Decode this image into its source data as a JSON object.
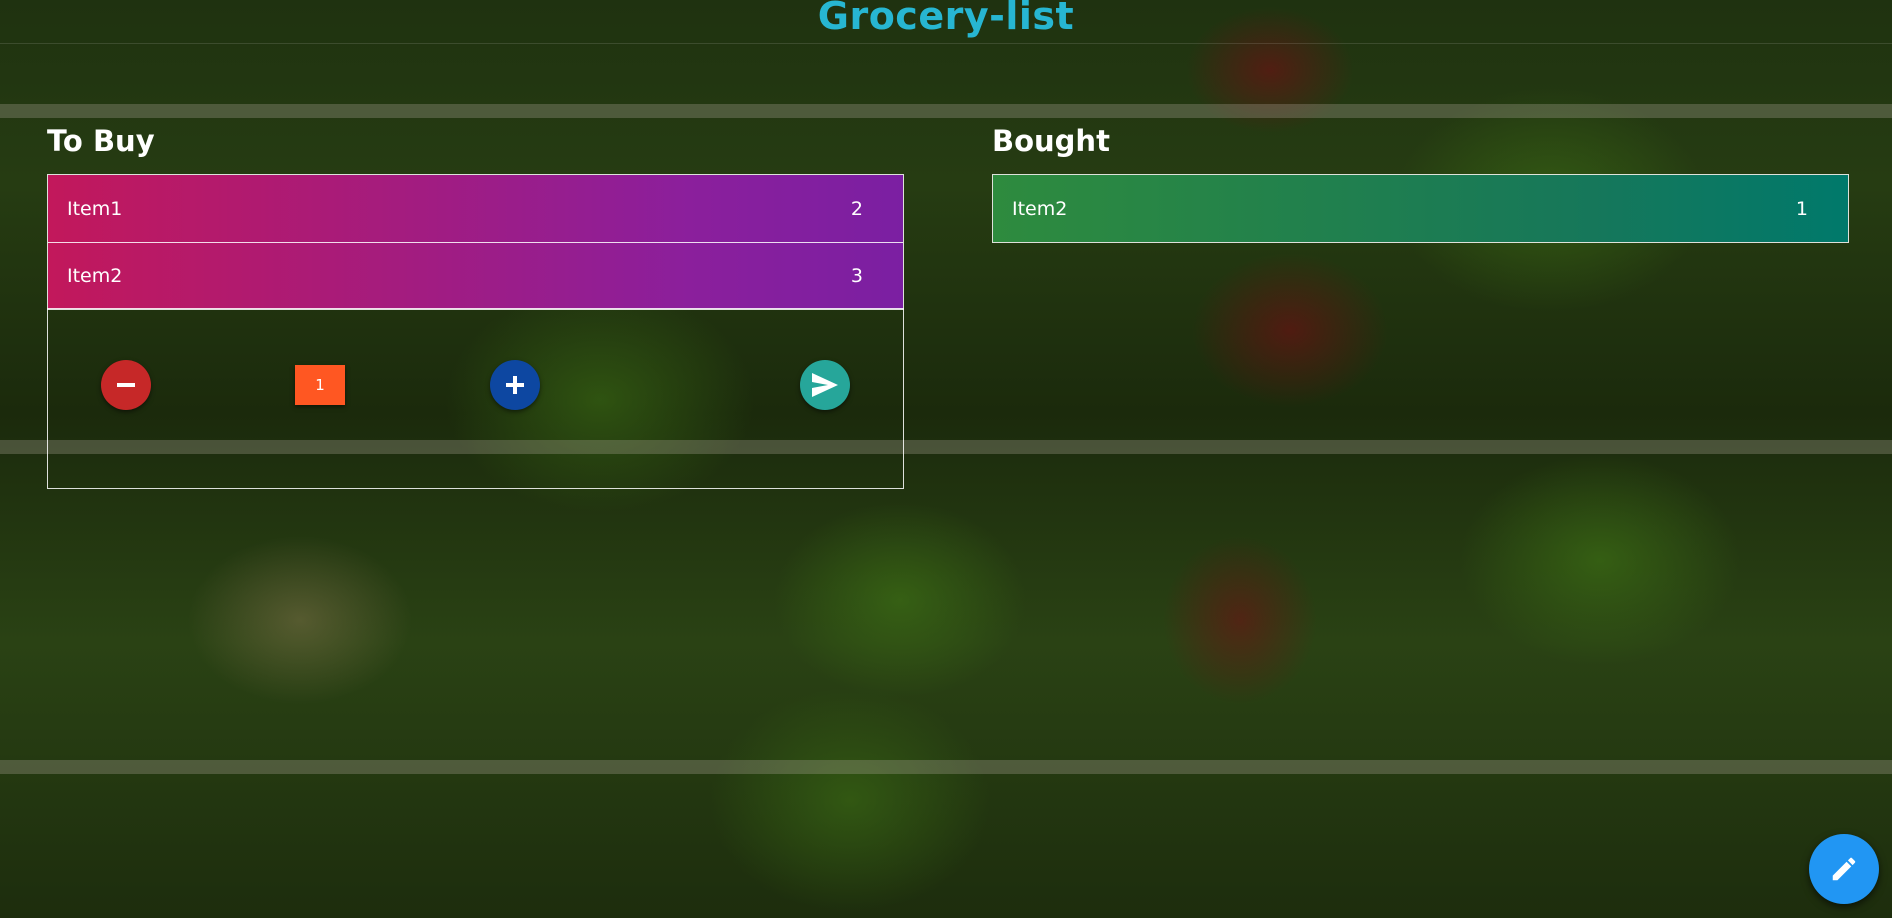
{
  "app": {
    "title": "Grocery-list"
  },
  "to_buy": {
    "heading": "To Buy",
    "items": [
      {
        "name": "Item1",
        "quantity": "2"
      },
      {
        "name": "Item2",
        "quantity": "3"
      }
    ]
  },
  "bought": {
    "heading": "Bought",
    "items": [
      {
        "name": "Item2",
        "quantity": "1"
      }
    ]
  },
  "controls": {
    "quantity_value": "1",
    "decrement_icon": "minus-icon",
    "increment_icon": "plus-icon",
    "submit_icon": "send-icon"
  },
  "fab": {
    "icon": "pencil-icon"
  },
  "colors": {
    "title": "#27b6d2",
    "to_buy_start": "#c2185b",
    "to_buy_end": "#7b1fa2",
    "bought_start": "#2e8b3e",
    "bought_end": "#00796b",
    "decrement": "#c62828",
    "increment": "#0d47a1",
    "submit": "#26a69a",
    "quantity_box": "#ff5722",
    "fab": "#2196f3"
  }
}
